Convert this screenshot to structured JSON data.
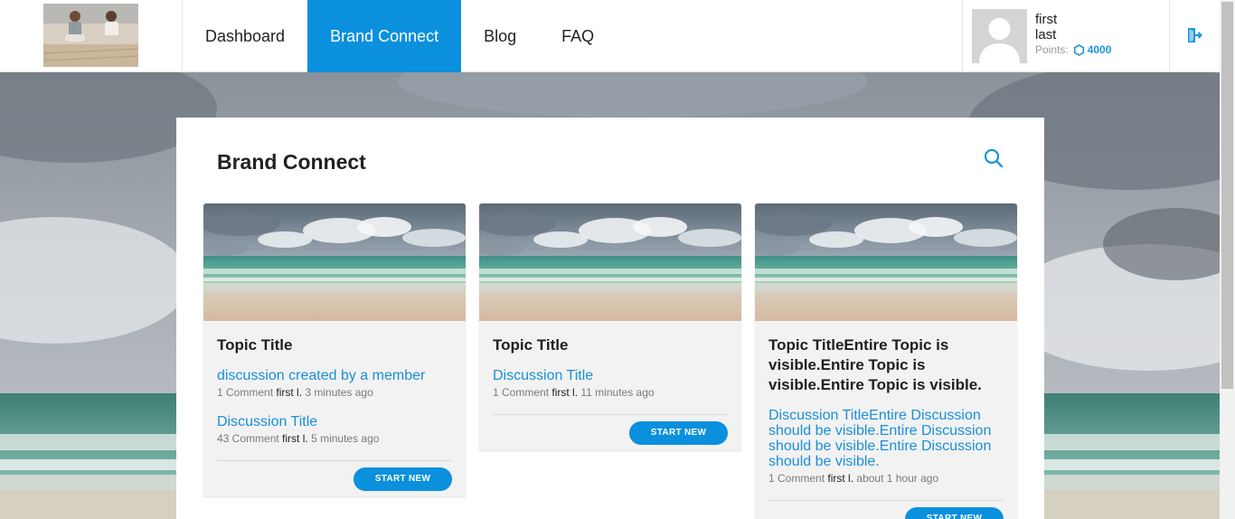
{
  "nav": {
    "items": [
      {
        "label": "Dashboard",
        "active": false
      },
      {
        "label": "Brand Connect",
        "active": true
      },
      {
        "label": "Blog",
        "active": false
      },
      {
        "label": "FAQ",
        "active": false
      }
    ]
  },
  "user": {
    "first_name": "first",
    "last_name": "last",
    "points_label": "Points:",
    "points_value": "4000"
  },
  "icons": {
    "logout": "logout-icon",
    "search": "search-icon",
    "points": "coin-icon"
  },
  "colors": {
    "accent": "#0a90dd",
    "link": "#1a8fd8"
  },
  "main": {
    "title": "Brand Connect",
    "cards": [
      {
        "topic_title": "Topic Title",
        "discussions": [
          {
            "title": "discussion created by a member",
            "comment_count": "1 Comment",
            "author": "first l.",
            "time": "3 minutes ago"
          },
          {
            "title": "Discussion Title",
            "comment_count": "43 Comment",
            "author": "first l.",
            "time": "5 minutes ago"
          }
        ],
        "button_label": "START NEW"
      },
      {
        "topic_title": "Topic Title",
        "discussions": [
          {
            "title": "Discussion Title",
            "comment_count": "1 Comment",
            "author": "first l.",
            "time": "11 minutes ago"
          }
        ],
        "button_label": "START NEW"
      },
      {
        "topic_title": "Topic TitleEntire Topic is visible.Entire Topic is visible.Entire Topic is visible.",
        "discussions": [
          {
            "title": "Discussion TitleEntire Discussion should be visible.Entire Discussion should be visible.Entire Discussion should be visible.",
            "comment_count": "1 Comment",
            "author": "first l.",
            "time": "about 1 hour ago"
          }
        ],
        "button_label": "START NEW"
      }
    ]
  }
}
